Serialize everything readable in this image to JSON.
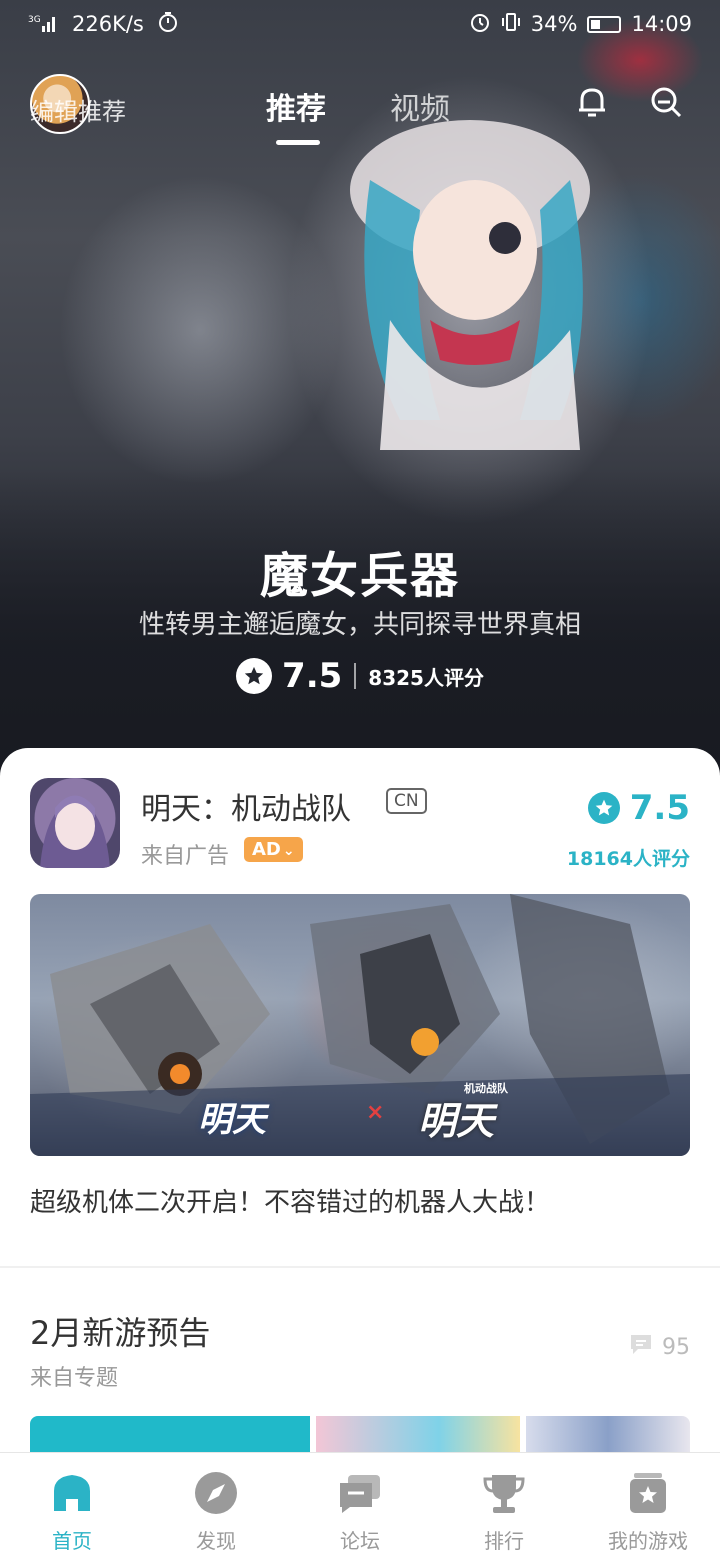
{
  "status_bar": {
    "network": "3G",
    "speed": "226K/s",
    "battery": "34%",
    "time": "14:09"
  },
  "top_nav": {
    "edit_recommend": "编辑推荐",
    "tabs": [
      {
        "label": "推荐",
        "active": true
      },
      {
        "label": "视频",
        "active": false
      }
    ]
  },
  "hero": {
    "title": "魔女兵器",
    "subtitle": "性转男主邂逅魔女，共同探寻世界真相",
    "score": "7.5",
    "ratings": "8325人评分"
  },
  "game_card": {
    "name": "明天：机动战队",
    "region_badge": "CN",
    "source": "来自广告",
    "ad_badge": "AD",
    "score": "7.5",
    "ratings": "18164人评分",
    "banner_logo_a": "明天",
    "banner_logo_x": "×",
    "banner_logo_b": "明天",
    "banner_logo_b_sub": "机动战队",
    "description": "超级机体二次开启！不容错过的机器人大战！"
  },
  "topic": {
    "title": "2月新游预告",
    "source": "来自专题",
    "comments": "95"
  },
  "bottom_nav": [
    {
      "label": "首页",
      "icon": "home-icon",
      "active": true
    },
    {
      "label": "发现",
      "icon": "compass-icon",
      "active": false
    },
    {
      "label": "论坛",
      "icon": "forum-icon",
      "active": false
    },
    {
      "label": "排行",
      "icon": "trophy-icon",
      "active": false
    },
    {
      "label": "我的游戏",
      "icon": "my-games-icon",
      "active": false
    }
  ],
  "colors": {
    "accent": "#2bb3c6",
    "ad_badge": "#f6a54a",
    "inactive_nav": "#9a9a9a"
  }
}
